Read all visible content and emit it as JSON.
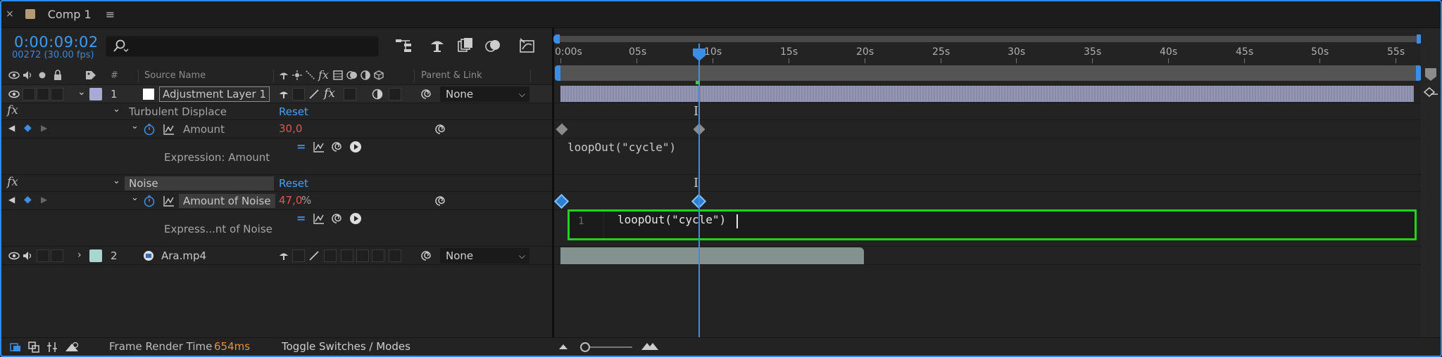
{
  "tab": {
    "close": "×",
    "title": "Comp 1",
    "menu": "≡"
  },
  "header": {
    "timecode": "0:00:09:02",
    "frame_info": "00272 (30.00 fps)",
    "search_placeholder": ""
  },
  "columns": {
    "hash": "#",
    "source_name": "Source Name",
    "parent_link": "Parent & Link"
  },
  "ruler": {
    "labels": [
      "0:00s",
      "05s",
      "10s",
      "15s",
      "20s",
      "25s",
      "30s",
      "35s",
      "40s",
      "45s",
      "50s",
      "55s"
    ]
  },
  "layers": [
    {
      "number": "1",
      "name": "Adjustment Layer 1",
      "parent": "None",
      "label_color": "#a9a9d8"
    },
    {
      "number": "2",
      "name": "Ara.mp4",
      "parent": "None",
      "label_color": "#a8d6d0"
    }
  ],
  "effects": {
    "turbulent": {
      "name": "Turbulent Displace",
      "reset": "Reset",
      "property": "Amount",
      "value": "30,0",
      "expression_label": "Expression: Amount",
      "expression": "loopOut(\"cycle\")"
    },
    "noise": {
      "name": "Noise",
      "reset": "Reset",
      "property": "Amount of Noise",
      "value": "47,0",
      "unit": "%",
      "expression_label": "Express...nt of Noise",
      "line_number": "1",
      "expression": "loopOut(\"cycle\")"
    }
  },
  "fx_label": "fx",
  "footer": {
    "frame_render_label": "Frame Render Time",
    "frame_render_value": "654ms",
    "toggle_label": "Toggle Switches / Modes"
  },
  "colors": {
    "accent": "#3a8ee6",
    "timecode": "#3d9bf2",
    "value_red": "#e25555",
    "highlight_green": "#1ed41e",
    "render_orange": "#e8913a"
  }
}
